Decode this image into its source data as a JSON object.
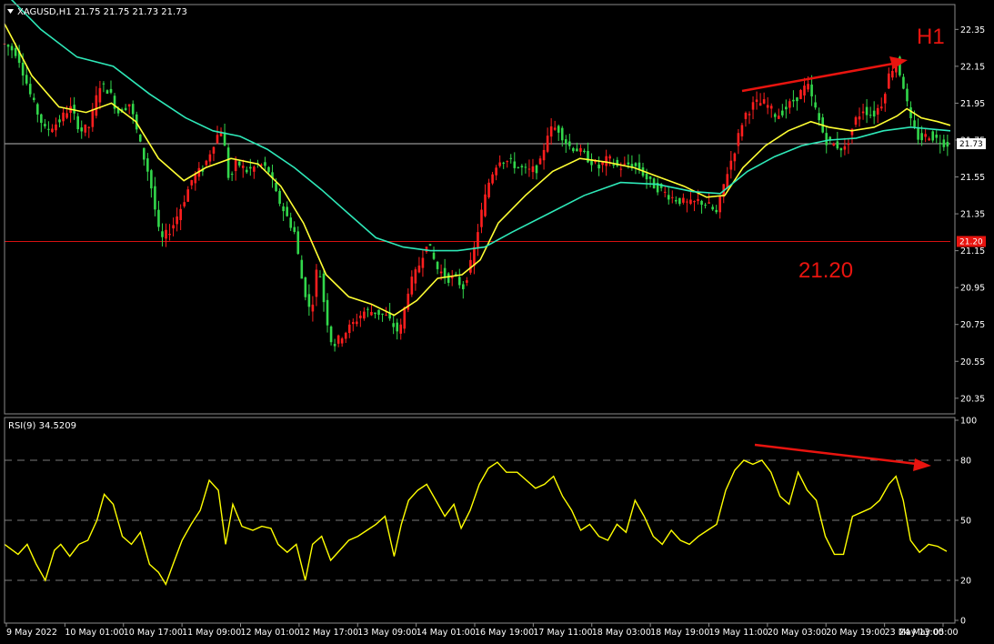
{
  "chart_data": [
    {
      "type": "candlestick",
      "title": "XAGUSD,H1  21.75 21.75 21.73 21.73",
      "ylim": [
        20.28,
        22.47
      ],
      "y_ticks": [
        "22.35",
        "22.15",
        "21.95",
        "21.75",
        "21.55",
        "21.35",
        "21.15",
        "20.95",
        "20.75",
        "20.55",
        "20.35"
      ],
      "y_tick_values": [
        22.35,
        22.15,
        21.95,
        21.75,
        21.55,
        21.35,
        21.15,
        20.95,
        20.75,
        20.55,
        20.35
      ],
      "x_labels": [
        "9 May 2022",
        "10 May 01:00",
        "10 May 17:00",
        "11 May 09:00",
        "12 May 01:00",
        "12 May 17:00",
        "13 May 09:00",
        "14 May 01:00",
        "16 May 19:00",
        "17 May 11:00",
        "18 May 03:00",
        "18 May 19:00",
        "19 May 11:00",
        "20 May 03:00",
        "20 May 19:00",
        "23 May 13:00",
        "24 May 05:00"
      ],
      "price_path": [
        [
          0,
          22.27
        ],
        [
          14,
          22.22
        ],
        [
          30,
          21.97
        ],
        [
          45,
          21.8
        ],
        [
          60,
          21.85
        ],
        [
          72,
          21.93
        ],
        [
          84,
          21.8
        ],
        [
          93,
          21.82
        ],
        [
          105,
          22.05
        ],
        [
          115,
          22.02
        ],
        [
          125,
          21.9
        ],
        [
          138,
          21.95
        ],
        [
          150,
          21.72
        ],
        [
          160,
          21.55
        ],
        [
          172,
          21.2
        ],
        [
          185,
          21.28
        ],
        [
          196,
          21.4
        ],
        [
          208,
          21.55
        ],
        [
          220,
          21.6
        ],
        [
          232,
          21.75
        ],
        [
          240,
          21.82
        ],
        [
          248,
          21.52
        ],
        [
          256,
          21.63
        ],
        [
          268,
          21.58
        ],
        [
          282,
          21.62
        ],
        [
          292,
          21.58
        ],
        [
          300,
          21.45
        ],
        [
          310,
          21.35
        ],
        [
          320,
          21.25
        ],
        [
          328,
          21.0
        ],
        [
          338,
          20.8
        ],
        [
          346,
          21.1
        ],
        [
          354,
          20.82
        ],
        [
          362,
          20.63
        ],
        [
          374,
          20.7
        ],
        [
          384,
          20.75
        ],
        [
          396,
          20.82
        ],
        [
          408,
          20.82
        ],
        [
          420,
          20.8
        ],
        [
          428,
          20.75
        ],
        [
          436,
          20.7
        ],
        [
          446,
          20.95
        ],
        [
          456,
          21.05
        ],
        [
          466,
          21.2
        ],
        [
          478,
          21.05
        ],
        [
          490,
          21.0
        ],
        [
          498,
          21.0
        ],
        [
          506,
          20.95
        ],
        [
          516,
          21.1
        ],
        [
          526,
          21.35
        ],
        [
          536,
          21.55
        ],
        [
          546,
          21.65
        ],
        [
          558,
          21.63
        ],
        [
          568,
          21.6
        ],
        [
          578,
          21.58
        ],
        [
          590,
          21.6
        ],
        [
          600,
          21.8
        ],
        [
          610,
          21.82
        ],
        [
          622,
          21.72
        ],
        [
          632,
          21.7
        ],
        [
          644,
          21.65
        ],
        [
          656,
          21.6
        ],
        [
          666,
          21.65
        ],
        [
          678,
          21.6
        ],
        [
          690,
          21.62
        ],
        [
          700,
          21.6
        ],
        [
          712,
          21.52
        ],
        [
          724,
          21.48
        ],
        [
          736,
          21.44
        ],
        [
          746,
          21.42
        ],
        [
          756,
          21.4
        ],
        [
          766,
          21.42
        ],
        [
          776,
          21.4
        ],
        [
          786,
          21.35
        ],
        [
          796,
          21.55
        ],
        [
          806,
          21.7
        ],
        [
          816,
          21.88
        ],
        [
          828,
          21.95
        ],
        [
          840,
          21.95
        ],
        [
          852,
          21.88
        ],
        [
          862,
          21.92
        ],
        [
          874,
          21.98
        ],
        [
          886,
          22.05
        ],
        [
          896,
          21.9
        ],
        [
          906,
          21.75
        ],
        [
          918,
          21.72
        ],
        [
          928,
          21.7
        ],
        [
          938,
          21.85
        ],
        [
          948,
          21.92
        ],
        [
          958,
          21.88
        ],
        [
          968,
          21.95
        ],
        [
          976,
          22.1
        ],
        [
          984,
          22.18
        ],
        [
          992,
          22.05
        ],
        [
          1000,
          21.85
        ],
        [
          1010,
          21.75
        ],
        [
          1020,
          21.78
        ],
        [
          1030,
          21.75
        ],
        [
          1040,
          21.73
        ]
      ],
      "series": [
        {
          "name": "",
          "color": "#ffff33",
          "points": [
            [
              0,
              22.38
            ],
            [
              30,
              22.1
            ],
            [
              60,
              21.93
            ],
            [
              90,
              21.9
            ],
            [
              118,
              21.95
            ],
            [
              145,
              21.85
            ],
            [
              170,
              21.65
            ],
            [
              198,
              21.53
            ],
            [
              222,
              21.6
            ],
            [
              250,
              21.65
            ],
            [
              280,
              21.62
            ],
            [
              305,
              21.5
            ],
            [
              330,
              21.3
            ],
            [
              355,
              21.02
            ],
            [
              380,
              20.9
            ],
            [
              405,
              20.86
            ],
            [
              430,
              20.8
            ],
            [
              455,
              20.88
            ],
            [
              478,
              21.0
            ],
            [
              505,
              21.02
            ],
            [
              525,
              21.1
            ],
            [
              545,
              21.3
            ],
            [
              575,
              21.45
            ],
            [
              605,
              21.58
            ],
            [
              635,
              21.65
            ],
            [
              665,
              21.63
            ],
            [
              695,
              21.6
            ],
            [
              722,
              21.55
            ],
            [
              750,
              21.5
            ],
            [
              775,
              21.44
            ],
            [
              795,
              21.45
            ],
            [
              815,
              21.6
            ],
            [
              840,
              21.72
            ],
            [
              865,
              21.8
            ],
            [
              890,
              21.85
            ],
            [
              910,
              21.82
            ],
            [
              935,
              21.8
            ],
            [
              960,
              21.82
            ],
            [
              985,
              21.88
            ],
            [
              996,
              21.92
            ],
            [
              1012,
              21.87
            ],
            [
              1030,
              21.85
            ],
            [
              1044,
              21.83
            ]
          ]
        },
        {
          "name": "",
          "color": "#2ee8b8",
          "points": [
            [
              0,
              22.55
            ],
            [
              40,
              22.35
            ],
            [
              80,
              22.2
            ],
            [
              120,
              22.15
            ],
            [
              160,
              22.0
            ],
            [
              200,
              21.87
            ],
            [
              230,
              21.8
            ],
            [
              260,
              21.77
            ],
            [
              290,
              21.7
            ],
            [
              320,
              21.6
            ],
            [
              350,
              21.48
            ],
            [
              380,
              21.35
            ],
            [
              410,
              21.22
            ],
            [
              440,
              21.17
            ],
            [
              470,
              21.15
            ],
            [
              500,
              21.15
            ],
            [
              530,
              21.17
            ],
            [
              560,
              21.25
            ],
            [
              600,
              21.35
            ],
            [
              640,
              21.45
            ],
            [
              680,
              21.52
            ],
            [
              720,
              21.51
            ],
            [
              760,
              21.47
            ],
            [
              790,
              21.46
            ],
            [
              820,
              21.58
            ],
            [
              850,
              21.66
            ],
            [
              880,
              21.72
            ],
            [
              910,
              21.75
            ],
            [
              940,
              21.76
            ],
            [
              970,
              21.8
            ],
            [
              1000,
              21.82
            ],
            [
              1044,
              21.8
            ]
          ]
        }
      ],
      "current_price": "21.73",
      "level_price": "21.20",
      "annotations": [
        "H1",
        "21.20"
      ]
    },
    {
      "type": "line",
      "title": "RSI(9) 34.5209",
      "ylim": [
        0,
        100
      ],
      "y_ticks": [
        "100",
        "80",
        "50",
        "20",
        "0"
      ],
      "y_tick_values": [
        100,
        80,
        50,
        20,
        0
      ],
      "levels": [
        80,
        50,
        20
      ],
      "series": [
        {
          "name": "",
          "color": "#ffff00",
          "points": [
            [
              0,
              38
            ],
            [
              15,
              33
            ],
            [
              25,
              38
            ],
            [
              35,
              28
            ],
            [
              45,
              20
            ],
            [
              55,
              35
            ],
            [
              62,
              38
            ],
            [
              72,
              32
            ],
            [
              82,
              38
            ],
            [
              92,
              40
            ],
            [
              102,
              50
            ],
            [
              110,
              63
            ],
            [
              120,
              58
            ],
            [
              130,
              42
            ],
            [
              140,
              38
            ],
            [
              150,
              44
            ],
            [
              160,
              28
            ],
            [
              170,
              24
            ],
            [
              178,
              18
            ],
            [
              186,
              28
            ],
            [
              196,
              40
            ],
            [
              206,
              48
            ],
            [
              216,
              55
            ],
            [
              226,
              70
            ],
            [
              236,
              65
            ],
            [
              244,
              38
            ],
            [
              252,
              58
            ],
            [
              262,
              47
            ],
            [
              274,
              45
            ],
            [
              284,
              47
            ],
            [
              294,
              46
            ],
            [
              302,
              38
            ],
            [
              312,
              34
            ],
            [
              322,
              38
            ],
            [
              332,
              20
            ],
            [
              340,
              38
            ],
            [
              350,
              42
            ],
            [
              360,
              30
            ],
            [
              370,
              35
            ],
            [
              380,
              40
            ],
            [
              390,
              42
            ],
            [
              400,
              45
            ],
            [
              410,
              48
            ],
            [
              420,
              52
            ],
            [
              430,
              32
            ],
            [
              438,
              48
            ],
            [
              446,
              60
            ],
            [
              456,
              65
            ],
            [
              466,
              68
            ],
            [
              476,
              60
            ],
            [
              486,
              52
            ],
            [
              496,
              58
            ],
            [
              504,
              46
            ],
            [
              514,
              55
            ],
            [
              524,
              68
            ],
            [
              534,
              76
            ],
            [
              544,
              79
            ],
            [
              554,
              74
            ],
            [
              566,
              74
            ],
            [
              576,
              70
            ],
            [
              586,
              66
            ],
            [
              596,
              68
            ],
            [
              606,
              72
            ],
            [
              616,
              62
            ],
            [
              626,
              55
            ],
            [
              636,
              45
            ],
            [
              646,
              48
            ],
            [
              656,
              42
            ],
            [
              666,
              40
            ],
            [
              676,
              48
            ],
            [
              686,
              44
            ],
            [
              696,
              60
            ],
            [
              706,
              52
            ],
            [
              716,
              42
            ],
            [
              726,
              38
            ],
            [
              736,
              45
            ],
            [
              746,
              40
            ],
            [
              756,
              38
            ],
            [
              766,
              42
            ],
            [
              776,
              45
            ],
            [
              786,
              48
            ],
            [
              796,
              65
            ],
            [
              806,
              75
            ],
            [
              816,
              80
            ],
            [
              826,
              78
            ],
            [
              836,
              80
            ],
            [
              846,
              74
            ],
            [
              856,
              62
            ],
            [
              866,
              58
            ],
            [
              876,
              74
            ],
            [
              886,
              65
            ],
            [
              896,
              60
            ],
            [
              906,
              42
            ],
            [
              916,
              33
            ],
            [
              926,
              33
            ],
            [
              936,
              52
            ],
            [
              946,
              54
            ],
            [
              956,
              56
            ],
            [
              966,
              60
            ],
            [
              976,
              68
            ],
            [
              984,
              72
            ],
            [
              992,
              60
            ],
            [
              1000,
              40
            ],
            [
              1010,
              34
            ],
            [
              1020,
              38
            ],
            [
              1030,
              37
            ],
            [
              1040,
              34.5
            ]
          ]
        }
      ]
    }
  ]
}
